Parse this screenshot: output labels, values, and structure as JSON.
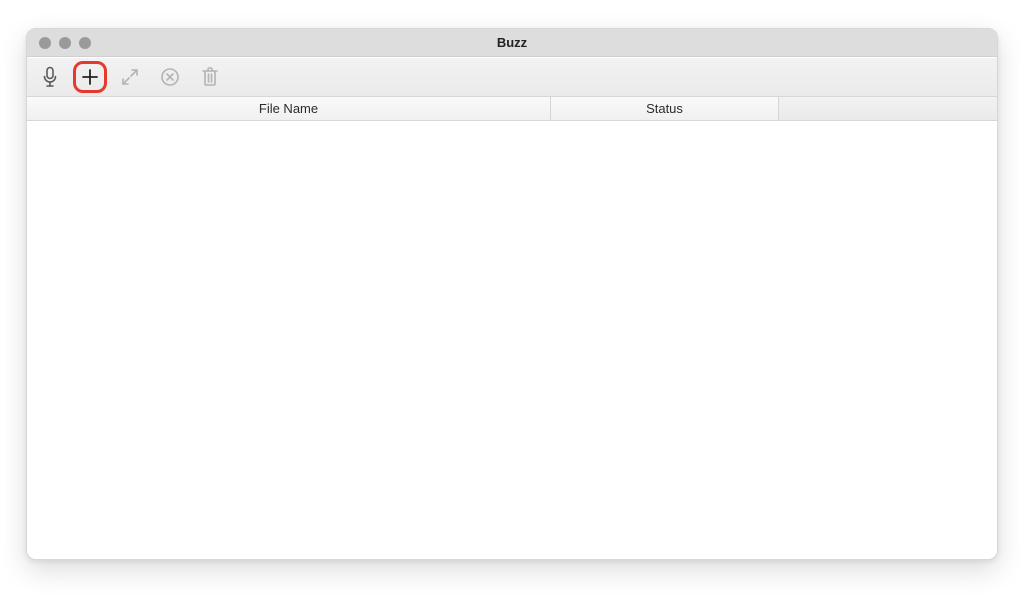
{
  "window": {
    "title": "Buzz"
  },
  "toolbar": {
    "buttons": [
      {
        "name": "microphone-icon",
        "disabled": false
      },
      {
        "name": "plus-icon",
        "disabled": false,
        "highlighted": true
      },
      {
        "name": "expand-icon",
        "disabled": true
      },
      {
        "name": "cancel-icon",
        "disabled": true
      },
      {
        "name": "trash-icon",
        "disabled": true
      }
    ]
  },
  "table": {
    "columns": {
      "filename": "File Name",
      "status": "Status"
    },
    "rows": []
  }
}
